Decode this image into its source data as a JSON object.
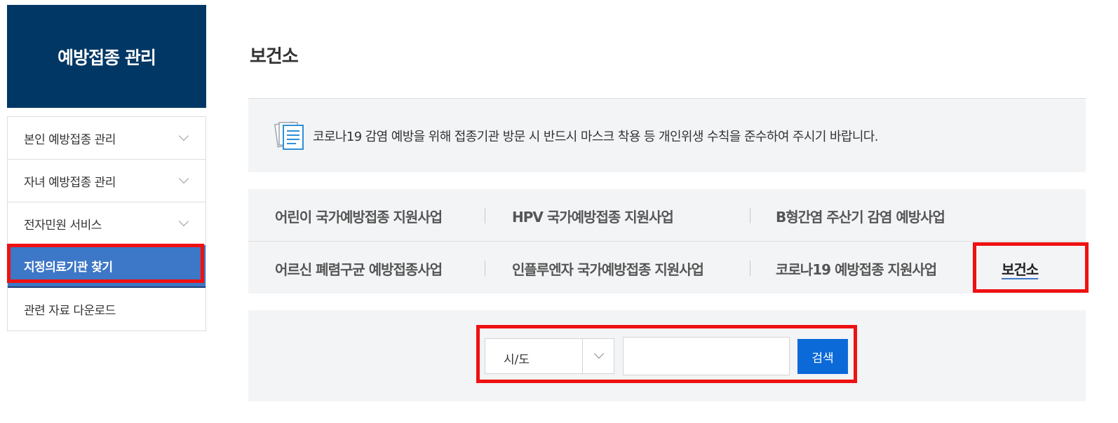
{
  "sidebar": {
    "title": "예방접종 관리",
    "items": [
      {
        "label": "본인 예방접종 관리",
        "icon": "chevron-down-icon"
      },
      {
        "label": "자녀 예방접종 관리",
        "icon": "chevron-down-icon"
      },
      {
        "label": "전자민원 서비스",
        "icon": "chevron-down-icon"
      },
      {
        "label": "지정의료기관 찾기"
      },
      {
        "label": "관련 자료 다운로드"
      }
    ]
  },
  "main": {
    "title": "보건소",
    "notice": {
      "icon": "document-icon",
      "text": "코로나19 감염 예방을 위해 접종기관 방문 시 반드시 마스크 착용 등 개인위생 수칙을 준수하여 주시기 바랍니다."
    },
    "tabs": {
      "row1": [
        "어린이 국가예방접종 지원사업",
        "HPV 국가예방접종 지원사업",
        "B형간염 주산기 감염 예방사업"
      ],
      "row2": [
        "어르신 폐렴구균 예방접종사업",
        "인플루엔자 국가예방접종 지원사업",
        "코로나19 예방접종 지원사업",
        "보건소"
      ]
    },
    "search": {
      "region_select_value": "시/도",
      "input_value": "",
      "button_label": "검색"
    }
  },
  "colors": {
    "sidebar_header_bg": "#003764",
    "active_menu_bg": "#3d77c7",
    "search_button_bg": "#0c6ad8",
    "highlight": "#ee1111"
  }
}
